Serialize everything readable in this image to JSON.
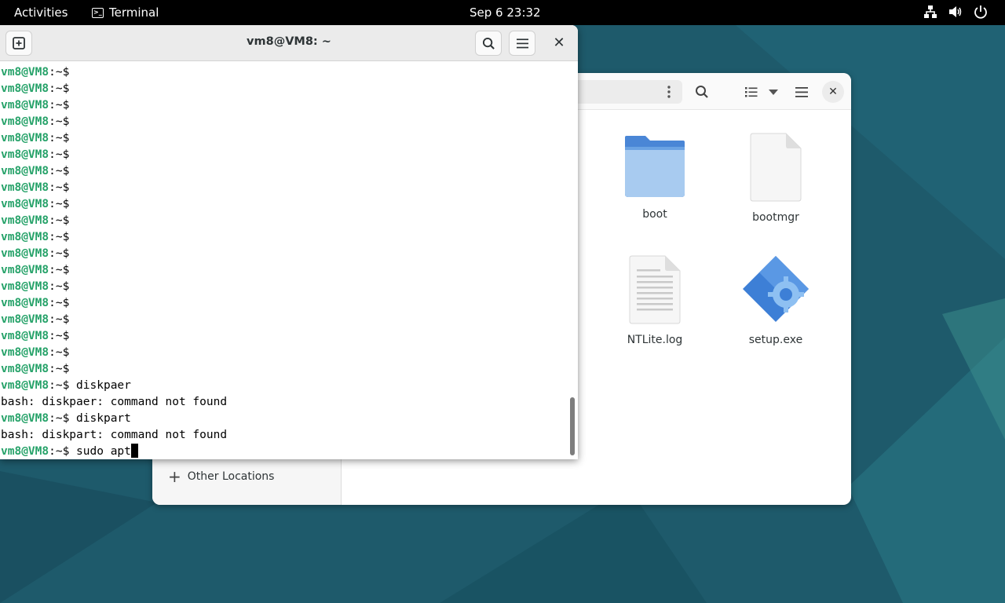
{
  "topbar": {
    "activities": "Activities",
    "app_name": "Terminal",
    "clock": "Sep 6  23:32",
    "tray_icons": [
      "network-icon",
      "volume-icon",
      "power-icon"
    ]
  },
  "terminal": {
    "title": "vm8@VM8: ~",
    "user_host": "vm8@VM8",
    "prompt_suffix": ":~$",
    "lines": [
      {
        "kind": "prompt",
        "cmd": ""
      },
      {
        "kind": "prompt",
        "cmd": ""
      },
      {
        "kind": "prompt",
        "cmd": ""
      },
      {
        "kind": "prompt",
        "cmd": ""
      },
      {
        "kind": "prompt",
        "cmd": ""
      },
      {
        "kind": "prompt",
        "cmd": ""
      },
      {
        "kind": "prompt",
        "cmd": ""
      },
      {
        "kind": "prompt",
        "cmd": ""
      },
      {
        "kind": "prompt",
        "cmd": ""
      },
      {
        "kind": "prompt",
        "cmd": ""
      },
      {
        "kind": "prompt",
        "cmd": ""
      },
      {
        "kind": "prompt",
        "cmd": ""
      },
      {
        "kind": "prompt",
        "cmd": ""
      },
      {
        "kind": "prompt",
        "cmd": ""
      },
      {
        "kind": "prompt",
        "cmd": ""
      },
      {
        "kind": "prompt",
        "cmd": ""
      },
      {
        "kind": "prompt",
        "cmd": ""
      },
      {
        "kind": "prompt",
        "cmd": ""
      },
      {
        "kind": "prompt",
        "cmd": ""
      },
      {
        "kind": "prompt",
        "cmd": " diskpaer"
      },
      {
        "kind": "output",
        "text": "bash: diskpaer: command not found"
      },
      {
        "kind": "prompt",
        "cmd": " diskpart"
      },
      {
        "kind": "output",
        "text": "bash: diskpart: command not found"
      },
      {
        "kind": "prompt",
        "cmd": " sudo apt",
        "cursor": true
      }
    ]
  },
  "files": {
    "items": [
      {
        "name": "boot",
        "icon": "folder-icon"
      },
      {
        "name": "bootmgr",
        "icon": "blank-file-icon"
      },
      {
        "name": "NTLite.log",
        "icon": "text-file-icon"
      },
      {
        "name": "setup.exe",
        "icon": "executable-icon"
      }
    ],
    "sidebar_other_locations": "Other Locations"
  },
  "colors": {
    "desktop": "#1f5b6c",
    "prompt_user": "#26a269",
    "folder": "#4a90d9"
  }
}
